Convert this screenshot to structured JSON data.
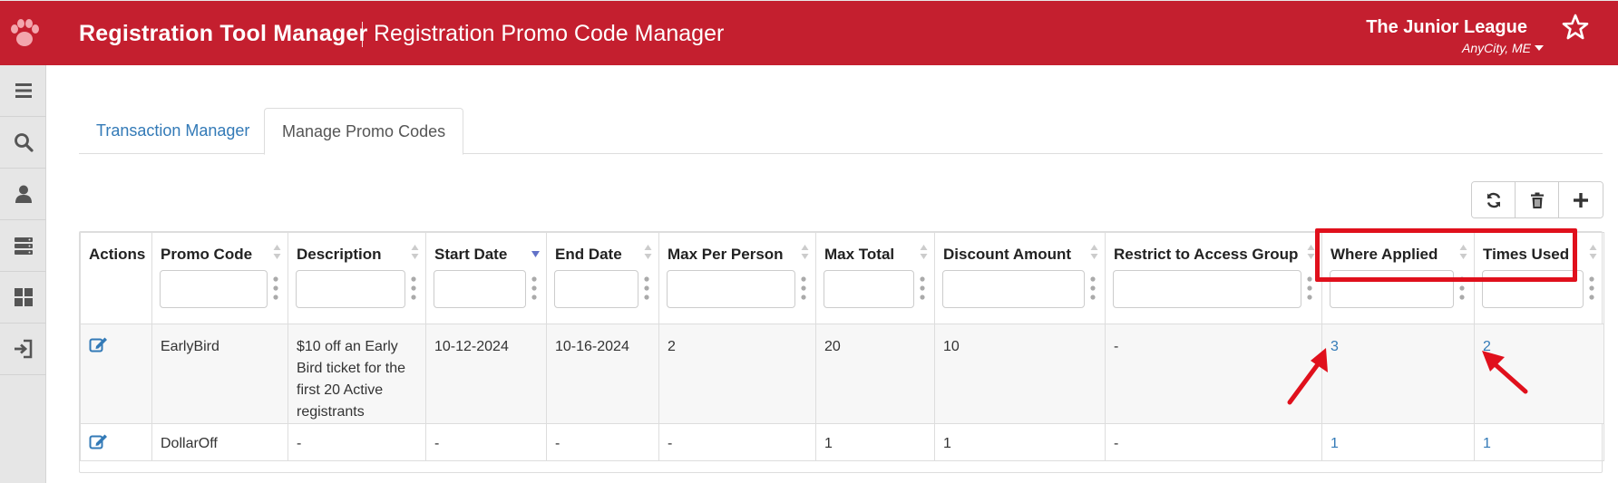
{
  "header": {
    "app_title": "Registration Tool Manager",
    "page_title": "Registration Promo Code Manager",
    "org_name": "The Junior League",
    "org_location": "AnyCity, ME",
    "brand_color": "#c41f2f"
  },
  "sidebar": {
    "items": [
      {
        "icon": "menu-icon"
      },
      {
        "icon": "search-icon"
      },
      {
        "icon": "user-icon"
      },
      {
        "icon": "server-icon"
      },
      {
        "icon": "dashboard-icon"
      },
      {
        "icon": "sign-in-icon"
      }
    ]
  },
  "tabs": [
    {
      "label": "Transaction Manager",
      "active": false
    },
    {
      "label": "Manage Promo Codes",
      "active": true
    }
  ],
  "toolbar": {
    "buttons": [
      {
        "icon": "refresh-icon"
      },
      {
        "icon": "trash-icon"
      },
      {
        "icon": "plus-icon"
      }
    ]
  },
  "table": {
    "columns": [
      "Actions",
      "Promo Code",
      "Description",
      "Start Date",
      "End Date",
      "Max Per Person",
      "Max Total",
      "Discount Amount",
      "Restrict to Access Group",
      "Where Applied",
      "Times Used"
    ],
    "rows": [
      {
        "promo_code": "EarlyBird",
        "description": "$10 off an Early Bird ticket for the first 20 Active registrants",
        "start_date": "10-12-2024",
        "end_date": "10-16-2024",
        "max_per_person": "2",
        "max_total": "20",
        "discount_amount": "10",
        "restrict_group": "-",
        "where_applied": "3",
        "times_used": "2"
      },
      {
        "promo_code": "DollarOff",
        "description": "-",
        "start_date": "-",
        "end_date": "-",
        "max_per_person": "-",
        "max_total": "1",
        "discount_amount": "1",
        "restrict_group": "-",
        "where_applied": "1",
        "times_used": "1"
      }
    ]
  },
  "annotations": {
    "highlight_color": "#e0101c"
  }
}
